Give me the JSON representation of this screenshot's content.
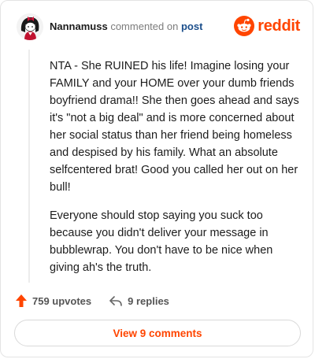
{
  "comment_header": {
    "username": "Nannamuss",
    "action_text": "commented on",
    "post_link": "post"
  },
  "brand": {
    "wordmark": "reddit",
    "icon": "reddit-logo-icon",
    "color": "#ff4500"
  },
  "avatar": {
    "icon": "snoo-avatar-icon"
  },
  "comment_body": {
    "paragraphs": [
      "NTA - She RUINED his life! Imagine losing your FAMILY and your HOME over your dumb friends boyfriend drama!! She then goes ahead and says it's \"not a big deal\" and is more concerned about her social status than her friend being homeless and despised by his family. What an absolute selfcentered brat! Good you called her out on her bull!",
      "Everyone should stop saying you suck too because you didn't deliver your message in bubblewrap. You don't have to be nice when giving ah's the truth."
    ]
  },
  "actions": {
    "upvotes": "759 upvotes",
    "upvote_icon": "upvote-arrow-icon",
    "upvote_color": "#ff4500",
    "replies": "9 replies",
    "reply_icon": "reply-arrow-icon"
  },
  "view_comments_button": {
    "label": "View 9 comments"
  }
}
